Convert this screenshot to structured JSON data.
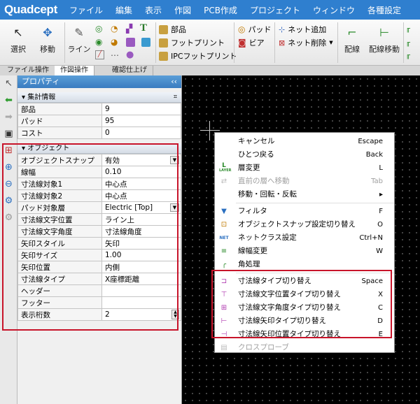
{
  "app": {
    "logo": "Quadcept"
  },
  "menubar": [
    "ファイル",
    "編集",
    "表示",
    "作図",
    "PCB作成",
    "プロジェクト",
    "ウィンドウ",
    "各種設定"
  ],
  "ribbon": {
    "select": "選択",
    "move": "移動",
    "line": "ライン",
    "part": "部品",
    "footprint": "フットプリント",
    "ipc_footprint": "IPCフットプリント",
    "pad": "パッド",
    "via": "ビア",
    "net_add": "ネット追加",
    "net_delete": "ネット削除",
    "wiring": "配線",
    "wiring_move": "配線移動"
  },
  "tabs": [
    "ファイル操作",
    "作図操作",
    "確認仕上げ"
  ],
  "panel": {
    "title": "プロパティ",
    "summary": {
      "header": "集計情報",
      "rows": [
        {
          "key": "部品",
          "value": "9"
        },
        {
          "key": "パッド",
          "value": "95"
        },
        {
          "key": "コスト",
          "value": "0"
        }
      ]
    },
    "object": {
      "header": "オブジェクト",
      "rows": [
        {
          "key": "オブジェクトスナップ",
          "value": "有効"
        },
        {
          "key": "線幅",
          "value": "0.10"
        },
        {
          "key": "寸法線対象1",
          "value": "中心点"
        },
        {
          "key": "寸法線対象2",
          "value": "中心点"
        },
        {
          "key": "パッド対象層",
          "value": "Electric [Top]"
        },
        {
          "key": "寸法線文字位置",
          "value": "ライン上"
        },
        {
          "key": "寸法線文字角度",
          "value": "寸法線角度"
        },
        {
          "key": "矢印スタイル",
          "value": "矢印"
        },
        {
          "key": "矢印サイズ",
          "value": "1.00"
        },
        {
          "key": "矢印位置",
          "value": "内側"
        },
        {
          "key": "寸法線タイプ",
          "value": "X座標距離"
        },
        {
          "key": "ヘッダー",
          "value": ""
        },
        {
          "key": "フッター",
          "value": ""
        },
        {
          "key": "表示桁数",
          "value": "2"
        }
      ]
    }
  },
  "context_menu": [
    {
      "label": "キャンセル",
      "key": "Escape"
    },
    {
      "label": "ひとつ戻る",
      "key": "Back"
    },
    {
      "label": "層変更",
      "key": "L"
    },
    {
      "label": "直前の層へ移動",
      "key": "Tab"
    },
    {
      "label": "移動・回転・反転",
      "key": "▸"
    },
    {
      "label": "フィルタ",
      "key": "F"
    },
    {
      "label": "オブジェクトスナップ設定切り替え",
      "key": "O"
    },
    {
      "label": "ネットクラス設定",
      "key": "Ctrl+N"
    },
    {
      "label": "線幅変更",
      "key": "W"
    },
    {
      "label": "角処理",
      "key": ""
    },
    {
      "label": "寸法線タイプ切り替え",
      "key": "Space"
    },
    {
      "label": "寸法線文字位置タイプ切り替え",
      "key": "X"
    },
    {
      "label": "寸法線文字角度タイプ切り替え",
      "key": "C"
    },
    {
      "label": "寸法線矢印タイプ切り替え",
      "key": "D"
    },
    {
      "label": "寸法線矢印位置タイプ切り替え",
      "key": "E"
    },
    {
      "label": "クロスプローブ",
      "key": ""
    }
  ],
  "icons": {
    "layer_icon_text": "LAYER",
    "netclass_icon_text": "NET"
  },
  "colors": {
    "menubar": "#2f7fcf",
    "panel_title": "#3a7cc0",
    "highlight_box": "#c8142a",
    "canvas": "#000000"
  }
}
